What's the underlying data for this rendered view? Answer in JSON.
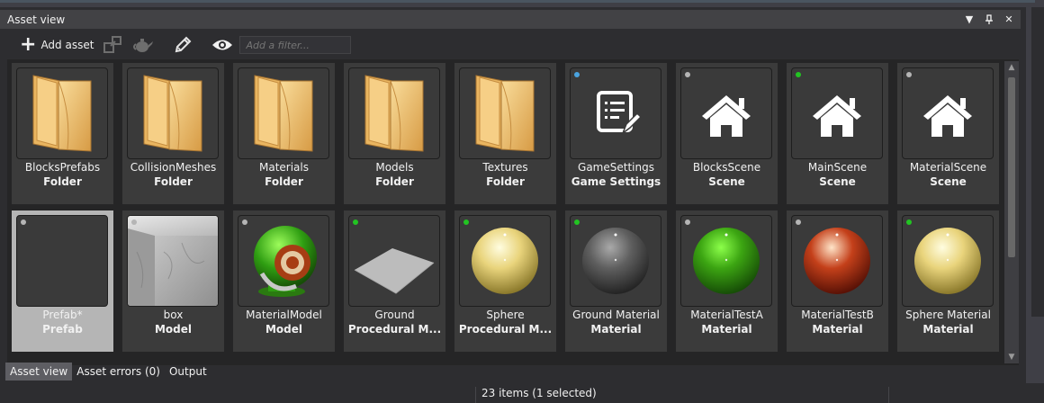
{
  "panel": {
    "title": "Asset view"
  },
  "toolbar": {
    "add_label": "Add asset",
    "filter_placeholder": "Add a filter..."
  },
  "tiles": [
    {
      "name": "BlocksPrefabs",
      "type": "Folder",
      "thumb": "folder",
      "status": null
    },
    {
      "name": "CollisionMeshes",
      "type": "Folder",
      "thumb": "folder",
      "status": null
    },
    {
      "name": "Materials",
      "type": "Folder",
      "thumb": "folder",
      "status": null
    },
    {
      "name": "Models",
      "type": "Folder",
      "thumb": "folder",
      "status": null
    },
    {
      "name": "Textures",
      "type": "Folder",
      "thumb": "folder",
      "status": null
    },
    {
      "name": "GameSettings",
      "type": "Game Settings",
      "thumb": "settings",
      "status": "#4aa3df"
    },
    {
      "name": "BlocksScene",
      "type": "Scene",
      "thumb": "scene",
      "status": "#b5b5b5"
    },
    {
      "name": "MainScene",
      "type": "Scene",
      "thumb": "scene",
      "status": "#22c422"
    },
    {
      "name": "MaterialScene",
      "type": "Scene",
      "thumb": "scene",
      "status": "#b5b5b5"
    },
    {
      "name": "Prefab*",
      "type": "Prefab",
      "thumb": "prefab",
      "status": "#b5b5b5",
      "selected": true
    },
    {
      "name": "box",
      "type": "Model",
      "thumb": "box",
      "status": "#b5b5b5"
    },
    {
      "name": "MaterialModel",
      "type": "Model",
      "thumb": "matmodel",
      "status": "#b5b5b5"
    },
    {
      "name": "Ground",
      "type": "Procedural M...",
      "thumb": "plane",
      "status": "#22c422"
    },
    {
      "name": "Sphere",
      "type": "Procedural M...",
      "thumb": "sphere-yellow",
      "status": "#22c422"
    },
    {
      "name": "Ground Material",
      "type": "Material",
      "thumb": "sphere-gray",
      "status": "#22c422"
    },
    {
      "name": "MaterialTestA",
      "type": "Material",
      "thumb": "sphere-green",
      "status": "#b5b5b5"
    },
    {
      "name": "MaterialTestB",
      "type": "Material",
      "thumb": "sphere-red",
      "status": "#b5b5b5"
    },
    {
      "name": "Sphere Material",
      "type": "Material",
      "thumb": "sphere-yellow",
      "status": "#22c422"
    }
  ],
  "tabs": [
    {
      "label": "Asset view",
      "active": true
    },
    {
      "label": "Asset errors (0)",
      "active": false
    },
    {
      "label": "Output",
      "active": false
    }
  ],
  "status": {
    "text": "23 items (1 selected)"
  }
}
